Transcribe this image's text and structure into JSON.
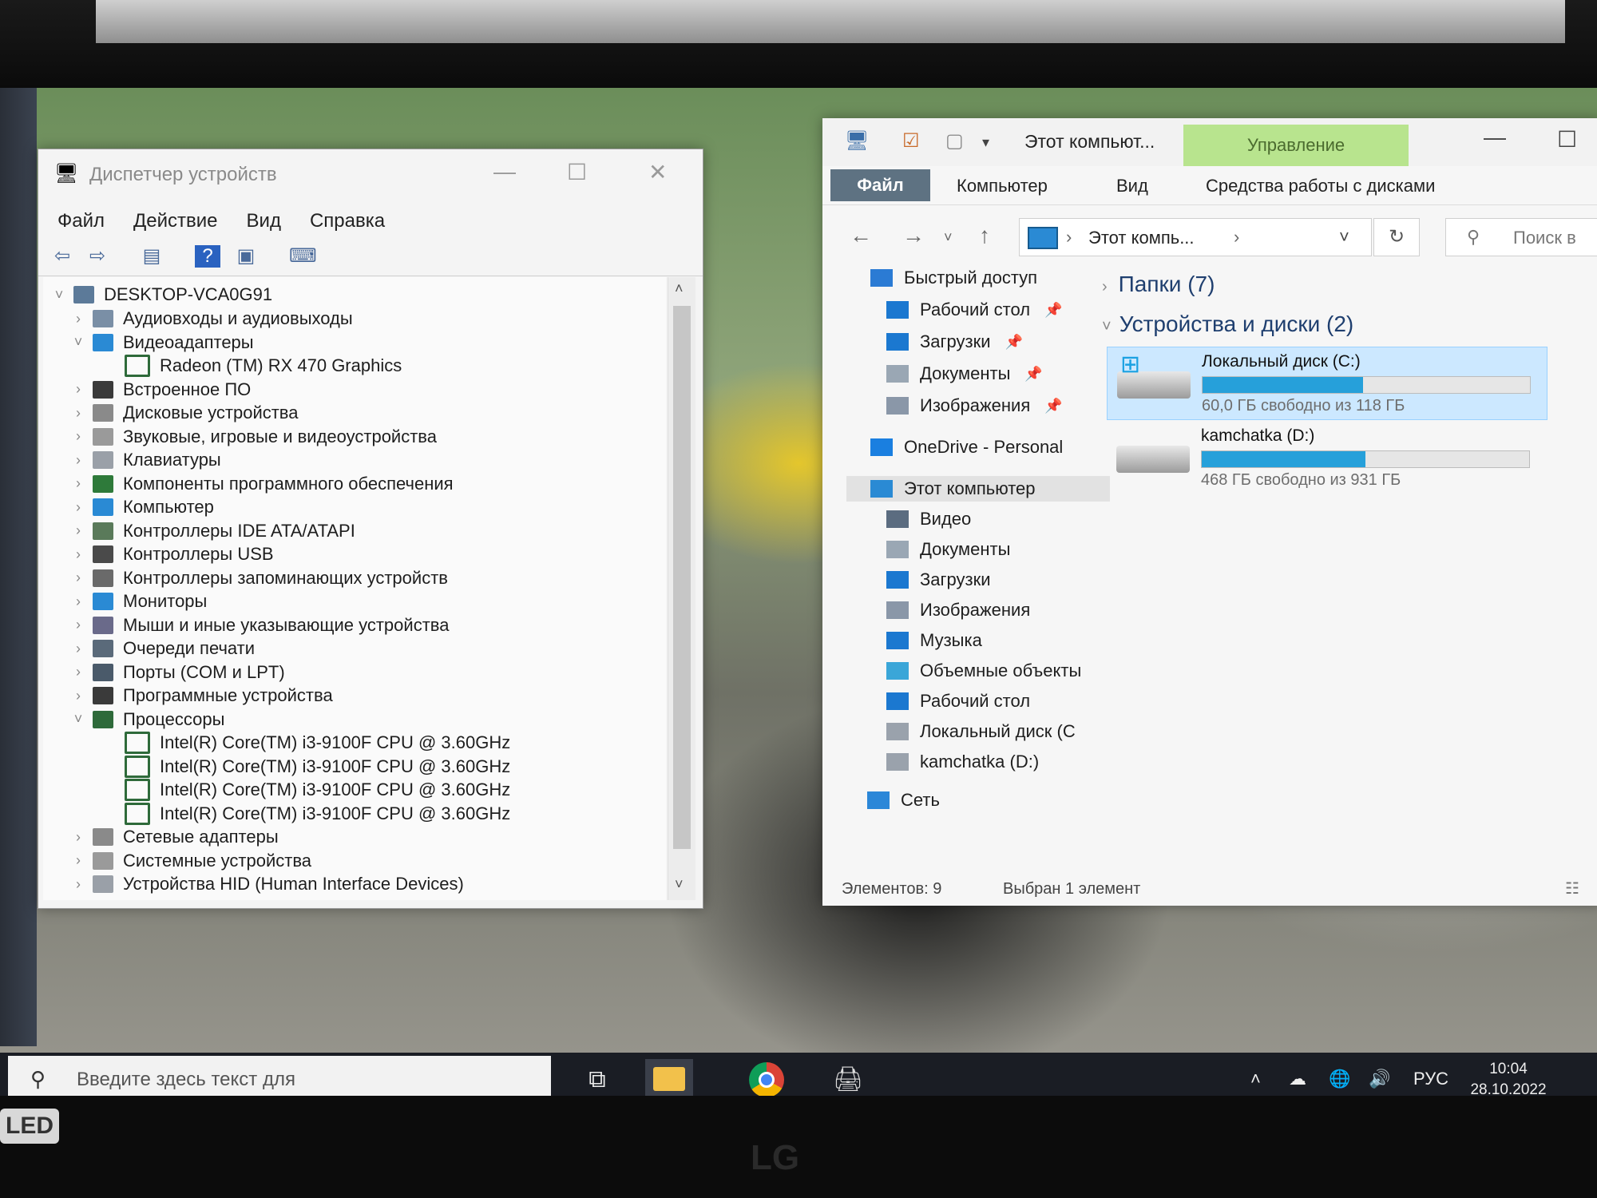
{
  "device_manager": {
    "title": "Диспетчер устройств",
    "menu": [
      "Файл",
      "Действие",
      "Вид",
      "Справка"
    ],
    "root": "DESKTOP-VCA0G91",
    "tree": [
      {
        "label": "Аудиовходы и аудиовыходы",
        "chev": "›"
      },
      {
        "label": "Видеоадаптеры",
        "chev": "˅"
      },
      {
        "label": "Radeon (TM) RX 470 Graphics",
        "child": true
      },
      {
        "label": "Встроенное ПО",
        "chev": "›"
      },
      {
        "label": "Дисковые устройства",
        "chev": "›"
      },
      {
        "label": "Звуковые, игровые и видеоустройства",
        "chev": "›"
      },
      {
        "label": "Клавиатуры",
        "chev": "›"
      },
      {
        "label": "Компоненты программного обеспечения",
        "chev": "›"
      },
      {
        "label": "Компьютер",
        "chev": "›"
      },
      {
        "label": "Контроллеры IDE ATA/ATAPI",
        "chev": "›"
      },
      {
        "label": "Контроллеры USB",
        "chev": "›"
      },
      {
        "label": "Контроллеры запоминающих устройств",
        "chev": "›"
      },
      {
        "label": "Мониторы",
        "chev": "›"
      },
      {
        "label": "Мыши и иные указывающие устройства",
        "chev": "›"
      },
      {
        "label": "Очереди печати",
        "chev": "›"
      },
      {
        "label": "Порты (COM и LPT)",
        "chev": "›"
      },
      {
        "label": "Программные устройства",
        "chev": "›"
      },
      {
        "label": "Процессоры",
        "chev": "˅"
      },
      {
        "label": "Intel(R) Core(TM) i3-9100F CPU @ 3.60GHz",
        "child": true
      },
      {
        "label": "Intel(R) Core(TM) i3-9100F CPU @ 3.60GHz",
        "child": true
      },
      {
        "label": "Intel(R) Core(TM) i3-9100F CPU @ 3.60GHz",
        "child": true
      },
      {
        "label": "Intel(R) Core(TM) i3-9100F CPU @ 3.60GHz",
        "child": true
      },
      {
        "label": "Сетевые адаптеры",
        "chev": "›"
      },
      {
        "label": "Системные устройства",
        "chev": "›"
      },
      {
        "label": "Устройства HID (Human Interface Devices)",
        "chev": "›"
      }
    ]
  },
  "explorer": {
    "title": "Этот компьют...",
    "manage_tab": "Управление",
    "tabs": [
      "Файл",
      "Компьютер",
      "Вид",
      "Средства работы с дисками"
    ],
    "address": "Этот компь...",
    "search_placeholder": "Поиск в",
    "nav": [
      {
        "label": "Быстрый доступ",
        "icon": "star-icon",
        "color": "#2b7bd4"
      },
      {
        "label": "Рабочий стол",
        "icon": "desktop-icon",
        "color": "#1b78d0",
        "pin": true
      },
      {
        "label": "Загрузки",
        "icon": "download-icon",
        "color": "#1b78d0",
        "pin": true
      },
      {
        "label": "Документы",
        "icon": "document-icon",
        "color": "#9aa7b4",
        "pin": true
      },
      {
        "label": "Изображения",
        "icon": "pictures-icon",
        "color": "#8a97a8",
        "pin": true
      },
      {
        "label": "OneDrive - Personal",
        "icon": "onedrive-icon",
        "color": "#1a7fe0"
      },
      {
        "label": "Этот компьютер",
        "icon": "computer-icon",
        "color": "#2a8ad4",
        "selected": true
      },
      {
        "label": "Видео",
        "icon": "video-icon",
        "color": "#5b6c80"
      },
      {
        "label": "Документы",
        "icon": "document-icon",
        "color": "#9aa7b4"
      },
      {
        "label": "Загрузки",
        "icon": "download-icon",
        "color": "#1b78d0"
      },
      {
        "label": "Изображения",
        "icon": "pictures-icon",
        "color": "#8a97a8"
      },
      {
        "label": "Музыка",
        "icon": "music-icon",
        "color": "#1b78d0"
      },
      {
        "label": "Объемные объекты",
        "icon": "3d-objects-icon",
        "color": "#3aa6d8"
      },
      {
        "label": "Рабочий стол",
        "icon": "desktop-icon",
        "color": "#1b78d0"
      },
      {
        "label": "Локальный диск (C",
        "icon": "drive-c-icon",
        "color": "#9aa2ac"
      },
      {
        "label": "kamchatka (D:)",
        "icon": "drive-d-icon",
        "color": "#9aa2ac"
      },
      {
        "label": "Сеть",
        "icon": "network-icon",
        "color": "#2b87d8"
      }
    ],
    "folders_group": "Папки (7)",
    "devices_group": "Устройства и диски (2)",
    "drives": [
      {
        "name": "Локальный диск (C:)",
        "free_text": "60,0 ГБ свободно из 118 ГБ",
        "used_fraction": 0.49,
        "selected": true
      },
      {
        "name": "kamchatka (D:)",
        "free_text": "468 ГБ свободно из 931 ГБ",
        "used_fraction": 0.5,
        "selected": false
      }
    ],
    "status_count": "Элементов: 9",
    "status_selected": "Выбран 1 элемент"
  },
  "taskbar": {
    "search_placeholder": "Введите здесь текст для",
    "language": "РУС",
    "time": "10:04",
    "date": "28.10.2022"
  },
  "monitor": {
    "led_badge": "LED",
    "brand": "LG"
  },
  "colors": {
    "accent": "#26a0da",
    "manage_tab": "#b8e48e",
    "file_tab": "#5e7282"
  }
}
